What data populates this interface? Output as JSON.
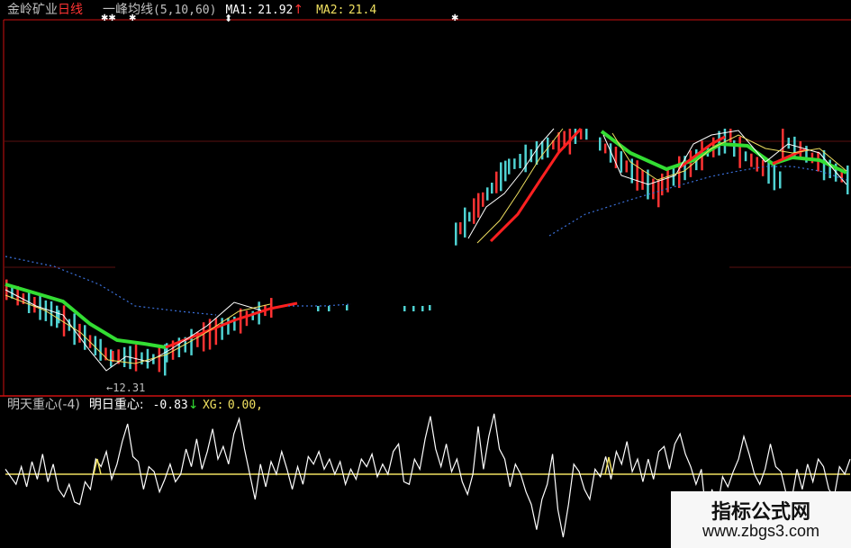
{
  "colors": {
    "background": "#000000",
    "frame": "#cc1111",
    "up_candle": "#ff3333",
    "down_candle": "#4fd2d2",
    "ma1": "#ffffff",
    "ma2": "#f0e060",
    "ma_long_green": "#33dd33",
    "ma_long_red": "#ff2020",
    "ma_dotted": "#3a6fd8",
    "label_gray": "#c0c0c0",
    "label_red": "#ff3333",
    "label_yellow": "#f0e060",
    "label_green": "#33dd33"
  },
  "header": {
    "stock_name": "金岭矿业",
    "period": "日线",
    "indicator": "一峰均线",
    "params": "(5,10,60)",
    "ma1_label": "MA1:",
    "ma1_value": "21.92",
    "ma1_arrow": "↑",
    "ma2_label": "MA2:",
    "ma2_value": "21.4",
    "marks": [
      "✱✱",
      "✱",
      "⬍",
      "✱"
    ]
  },
  "price_chart": {
    "low_annotation": "←12.31"
  },
  "indicator_panel": {
    "name": "明天重心(-4)",
    "series_label": "明日重心:",
    "series_value": "-0.83",
    "series_arrow": "↓",
    "xg_label": "XG:",
    "xg_value": "0.00,",
    "baseline_level": 0,
    "values": [
      0.2,
      -0.1,
      -0.4,
      0.3,
      -0.5,
      0.5,
      -0.2,
      0.8,
      -0.3,
      0.4,
      -0.6,
      -0.9,
      -0.4,
      -1.1,
      -1.2,
      -0.3,
      -0.6,
      0.6,
      0.3,
      0.9,
      -0.2,
      0.4,
      1.3,
      2.0,
      0.7,
      0.5,
      -0.6,
      0.3,
      0.1,
      -0.7,
      -0.2,
      0.4,
      -0.3,
      0.0,
      1.0,
      0.3,
      1.4,
      0.2,
      0.9,
      1.8,
      0.6,
      1.1,
      0.4,
      1.6,
      2.2,
      1.0,
      0.0,
      -1.0,
      0.4,
      -0.5,
      0.5,
      0.0,
      0.9,
      0.2,
      -0.6,
      0.3,
      -0.4,
      0.7,
      0.4,
      0.9,
      0.2,
      0.6,
      0.0,
      0.5,
      -0.4,
      0.2,
      -0.2,
      0.6,
      0.3,
      0.8,
      -0.1,
      0.4,
      0.0,
      0.9,
      1.2,
      -0.3,
      -0.4,
      0.6,
      0.2,
      1.4,
      2.3,
      1.0,
      0.3,
      1.2,
      0.1,
      0.6,
      -0.3,
      -0.8,
      0.0,
      1.9,
      0.2,
      1.5,
      2.4,
      1.0,
      0.6,
      -0.5,
      0.4,
      0.0,
      -0.7,
      -1.2,
      -2.2,
      -1.0,
      -0.4,
      0.8,
      -1.4,
      -2.5,
      -1.2,
      0.4,
      0.1,
      -0.6,
      -1.0,
      0.2,
      -0.1,
      0.7,
      -0.2,
      0.9,
      0.4,
      1.3,
      0.1,
      0.6,
      -0.3,
      0.6,
      -0.2,
      0.9,
      1.1,
      0.2,
      1.2,
      1.6,
      0.8,
      0.3,
      -0.4,
      0.2,
      -1.8,
      -0.6,
      -1.4,
      -0.1,
      -0.5,
      0.1,
      0.6,
      1.5,
      0.8,
      0.0,
      -0.4,
      0.2,
      1.2,
      0.3,
      0.1,
      -0.8,
      -1.0,
      0.2,
      -0.6,
      0.4,
      -0.3,
      0.6,
      0.3,
      -0.6,
      -0.9,
      0.3,
      0.0,
      0.6
    ]
  },
  "watermark": {
    "title": "指标公式网",
    "url": "www.zbgs3.com"
  }
}
